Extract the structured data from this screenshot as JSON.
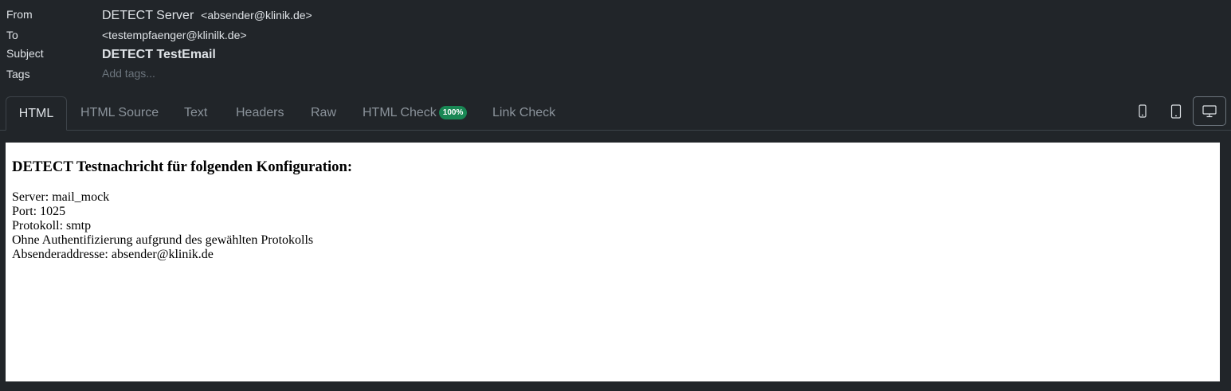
{
  "headers": {
    "from_label": "From",
    "from_name": "DETECT Server",
    "from_address": "<absender@klinik.de>",
    "to_label": "To",
    "to_address": "<testempfaenger@klinilk.de>",
    "subject_label": "Subject",
    "subject": "DETECT TestEmail",
    "tags_label": "Tags",
    "tags_placeholder": "Add tags..."
  },
  "tabs": [
    {
      "label": "HTML",
      "active": true
    },
    {
      "label": "HTML Source"
    },
    {
      "label": "Text"
    },
    {
      "label": "Headers"
    },
    {
      "label": "Raw"
    },
    {
      "label": "HTML Check",
      "badge": "100%"
    },
    {
      "label": "Link Check"
    }
  ],
  "device_buttons": [
    {
      "icon": "phone-icon"
    },
    {
      "icon": "tablet-icon"
    },
    {
      "icon": "desktop-icon",
      "active": true
    }
  ],
  "colors": {
    "background": "#212529",
    "badge": "#198754"
  },
  "message": {
    "heading": "DETECT Testnachricht für folgenden Konfiguration:",
    "lines": [
      "Server: mail_mock",
      "Port: 1025",
      "Protokoll: smtp",
      "Ohne Authentifizierung aufgrund des gewählten Protokolls",
      "Absenderaddresse: absender@klinik.de"
    ]
  }
}
